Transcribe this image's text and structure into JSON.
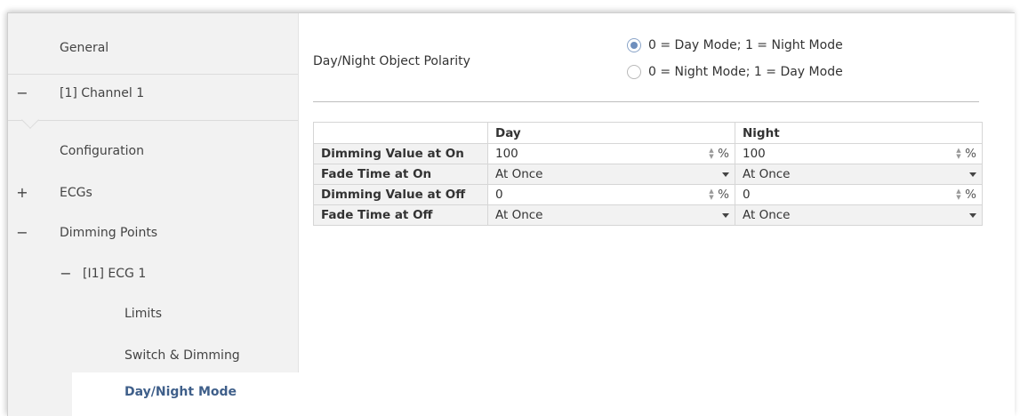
{
  "sidebar": {
    "general": "General",
    "channel": {
      "toggle": "−",
      "label": "[1] Channel 1"
    },
    "configuration": "Configuration",
    "ecgs": {
      "toggle": "+",
      "label": "ECGs"
    },
    "dimming_points": {
      "toggle": "−",
      "label": "Dimming Points"
    },
    "ecg1": {
      "toggle": "−",
      "label": "[I1] ECG 1"
    },
    "limits": "Limits",
    "switch_dimming": "Switch & Dimming",
    "day_night": "Day/Night Mode"
  },
  "polarity": {
    "label": "Day/Night Object Polarity",
    "options": [
      {
        "label": "0 = Day Mode; 1 = Night Mode",
        "checked": true
      },
      {
        "label": "0 = Night Mode; 1 = Day Mode",
        "checked": false
      }
    ]
  },
  "table": {
    "headers": [
      "",
      "Day",
      "Night"
    ],
    "rows": [
      {
        "label": "Dimming Value at On",
        "day": "100",
        "night": "100",
        "unit": "%"
      },
      {
        "label": "Fade Time at On",
        "day": "At Once",
        "night": "At Once"
      },
      {
        "label": "Dimming Value at Off",
        "day": "0",
        "night": "0",
        "unit": "%"
      },
      {
        "label": "Fade Time at Off",
        "day": "At Once",
        "night": "At Once"
      }
    ]
  },
  "icons": {
    "spinner": "spinner-updown-icon",
    "dropdown": "chevron-down-icon",
    "radio": "radio-button-icon"
  },
  "colors": {
    "sidebar_bg": "#f2f2f2",
    "selected_text": "#3f5f8a",
    "radio_accent": "#6f8fbd"
  }
}
